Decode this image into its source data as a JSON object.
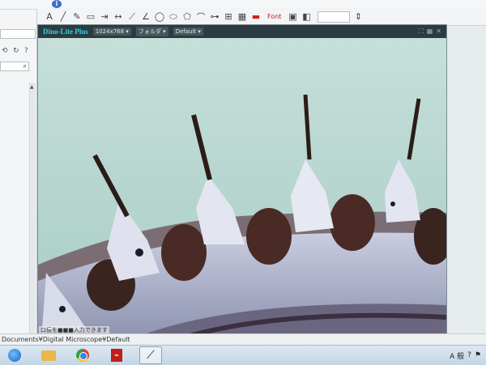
{
  "toolbar": {
    "font_label": "Font",
    "tools": [
      "text-tool",
      "line-tool",
      "arrow-tool",
      "rectangle-tool",
      "ellipse-tool",
      "polyline-tool",
      "measure-tool",
      "angle-tool",
      "circle-tool",
      "polygon-tool",
      "arc-tool",
      "line-color-tool",
      "fill-tool"
    ]
  },
  "viewer": {
    "brand": "Dino-Lite Plus",
    "resolution": "1024x768",
    "folder_dd": "フォルダ",
    "default_dd": "Default"
  },
  "status_text": "口伝を■■■入力できます",
  "path": "Documents¥Digital Microscope¥Default",
  "taskbar": {
    "tray_text": "A 般",
    "apps": [
      "start-button",
      "explorer",
      "chrome",
      "acrobat",
      "microscope-app"
    ]
  },
  "colors": {
    "viewer_bar": "#2c3b42",
    "brand": "#29d6e6",
    "background": "#bfd9d4"
  }
}
